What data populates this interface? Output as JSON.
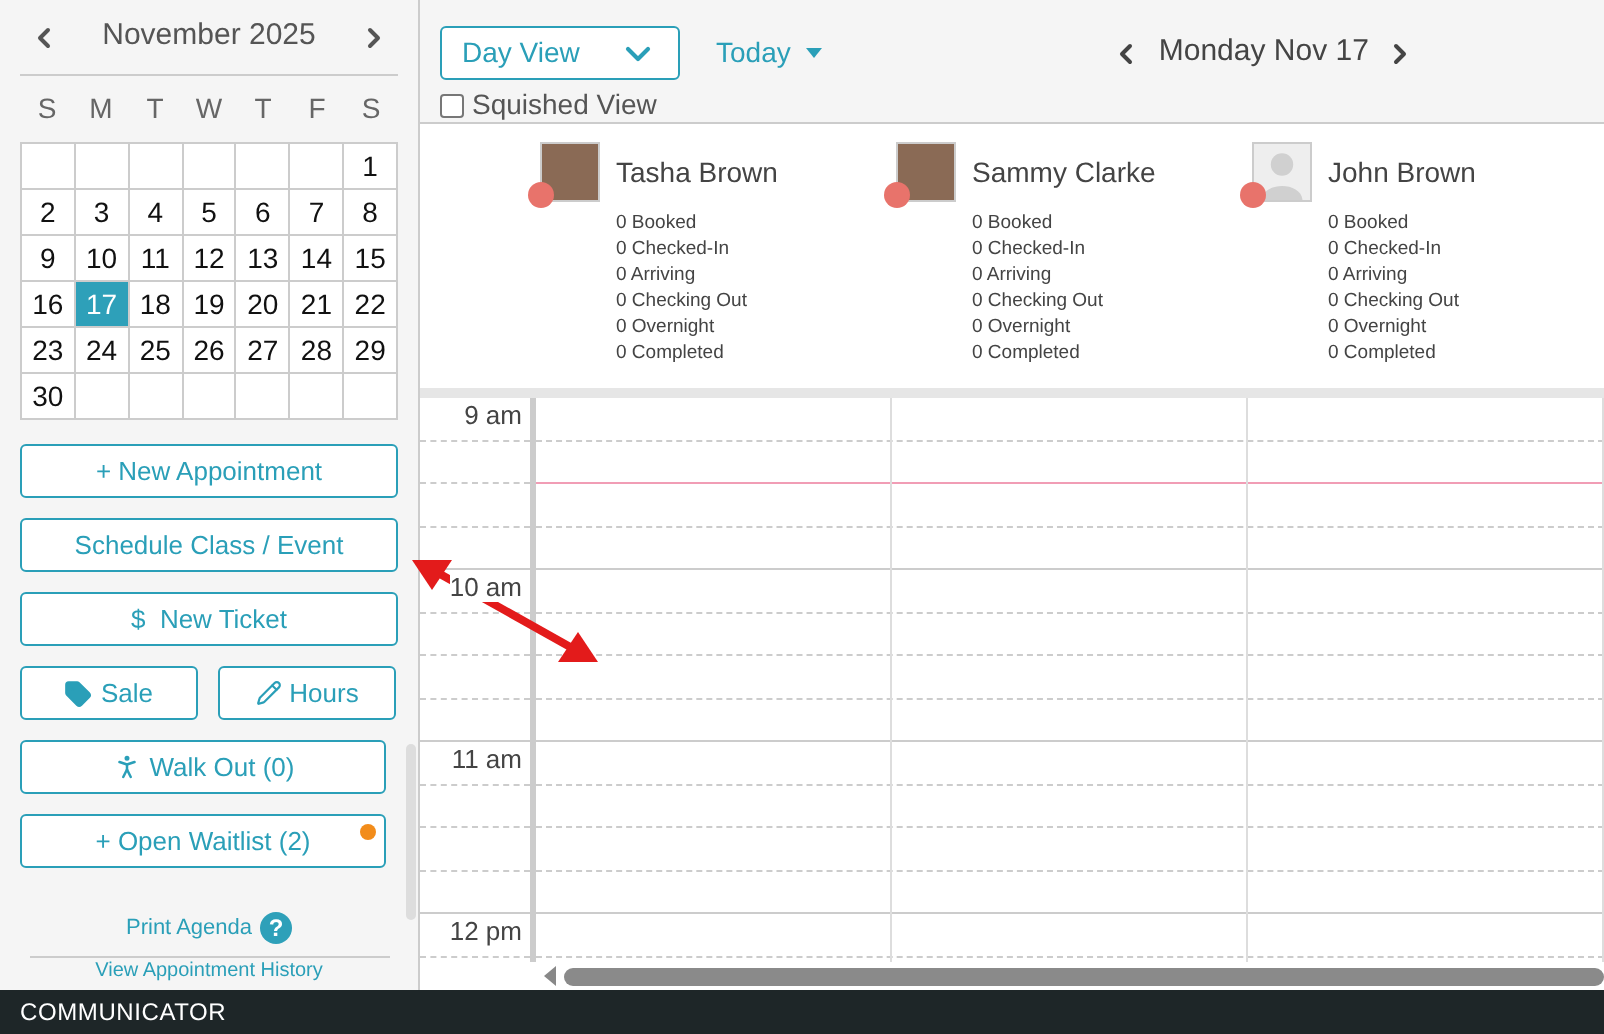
{
  "calendar": {
    "month": "November 2025",
    "weekdays": [
      "S",
      "M",
      "T",
      "W",
      "T",
      "F",
      "S"
    ],
    "days": [
      {
        "day": "1",
        "selected": false
      },
      {
        "day": "2",
        "selected": false
      },
      {
        "day": "3",
        "selected": false
      },
      {
        "day": "4",
        "selected": false
      },
      {
        "day": "5",
        "selected": false
      },
      {
        "day": "6",
        "selected": false
      },
      {
        "day": "7",
        "selected": false
      },
      {
        "day": "8",
        "selected": false
      },
      {
        "day": "9",
        "selected": false
      },
      {
        "day": "10",
        "selected": false
      },
      {
        "day": "11",
        "selected": false
      },
      {
        "day": "12",
        "selected": false
      },
      {
        "day": "13",
        "selected": false
      },
      {
        "day": "14",
        "selected": false
      },
      {
        "day": "15",
        "selected": false
      },
      {
        "day": "16",
        "selected": false
      },
      {
        "day": "17",
        "selected": true
      },
      {
        "day": "18",
        "selected": false
      },
      {
        "day": "19",
        "selected": false
      },
      {
        "day": "20",
        "selected": false
      },
      {
        "day": "21",
        "selected": false
      },
      {
        "day": "22",
        "selected": false
      },
      {
        "day": "23",
        "selected": false
      },
      {
        "day": "24",
        "selected": false
      },
      {
        "day": "25",
        "selected": false
      },
      {
        "day": "26",
        "selected": false
      },
      {
        "day": "27",
        "selected": false
      },
      {
        "day": "28",
        "selected": false
      },
      {
        "day": "29",
        "selected": false
      },
      {
        "day": "30",
        "selected": false
      }
    ]
  },
  "actions": [
    {
      "label": "+ New Appointment",
      "kind": "plain",
      "badge": false
    },
    {
      "label": "Schedule Class / Event",
      "kind": "plain",
      "badge": false
    },
    {
      "label": "$  New Ticket",
      "kind": "plain",
      "badge": false
    },
    {
      "label": "Sale",
      "kind": "tag",
      "badge": false
    },
    {
      "label": "Hours",
      "kind": "pencil",
      "badge": false
    },
    {
      "label": "Walk Out (0)",
      "kind": "walk",
      "badge": false
    },
    {
      "label": "+ Open Waitlist (2)",
      "kind": "plain",
      "badge": true
    }
  ],
  "print_agenda": {
    "label": "Print Agenda",
    "help": "?"
  },
  "history_link": "View Appointment History",
  "toolbar": {
    "view": "Day View",
    "today": "Today",
    "date": "Monday Nov 17",
    "squished": {
      "label": "Squished View",
      "checked": false
    }
  },
  "staff": [
    {
      "name": "Tasha Brown",
      "kind": "photo",
      "color": "#e8736b",
      "stats": [
        "0 Booked",
        "0 Checked-In",
        "0 Arriving",
        "0 Checking Out",
        "0 Overnight",
        "0 Completed"
      ]
    },
    {
      "name": "Sammy Clarke",
      "kind": "photo",
      "color": "#e8736b",
      "stats": [
        "0 Booked",
        "0 Checked-In",
        "0 Arriving",
        "0 Checking Out",
        "0 Overnight",
        "0 Completed"
      ]
    },
    {
      "name": "John Brown",
      "kind": "silhouette",
      "color": "#e8736b",
      "stats": [
        "0 Booked",
        "0 Checked-In",
        "0 Arriving",
        "0 Checking Out",
        "0 Overnight",
        "0 Completed"
      ]
    }
  ],
  "times": [
    "9 am",
    "10 am",
    "11 am",
    "12 pm"
  ],
  "bottom_bar": "COMMUNICATOR"
}
